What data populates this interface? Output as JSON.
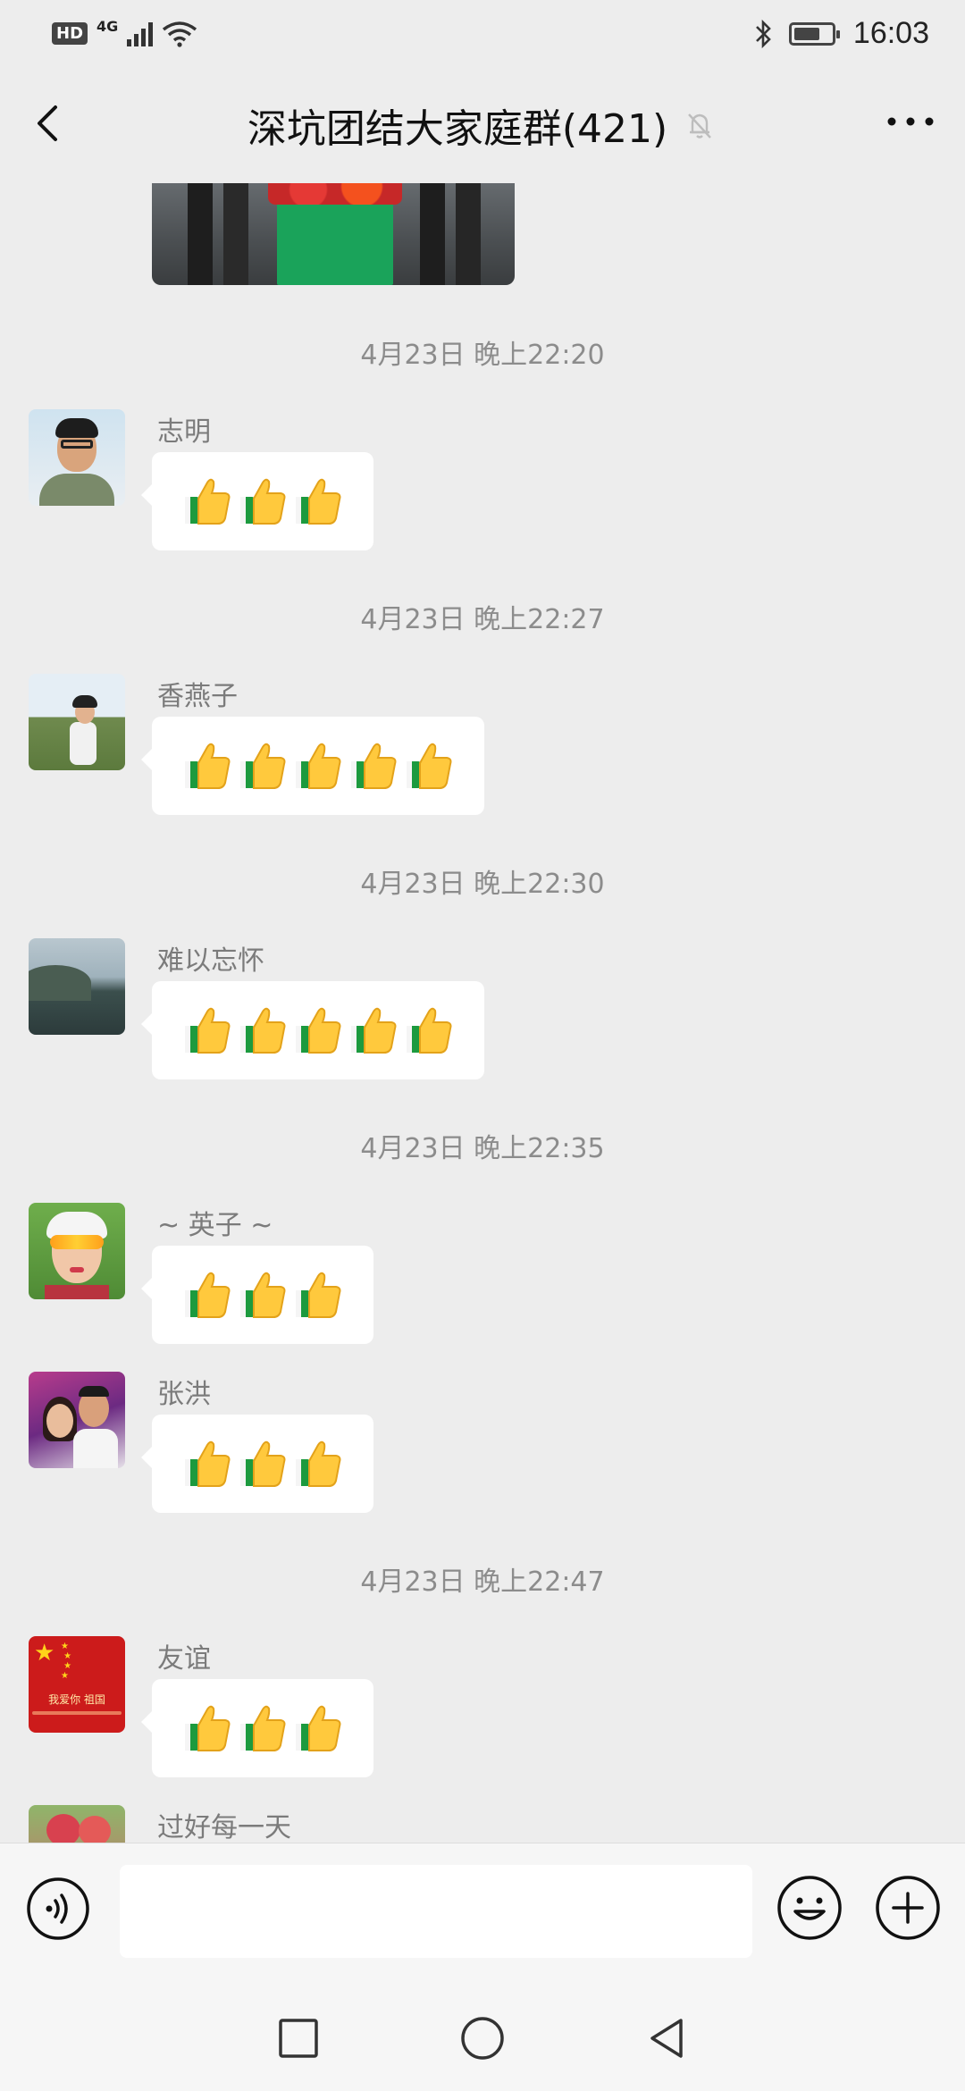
{
  "status_bar": {
    "hd": "HD",
    "network": "4G",
    "time": "16:03"
  },
  "header": {
    "title": "深坑团结大家庭群(421)"
  },
  "messages": [
    {
      "time": "4月23日 晚上22:20",
      "sender": "志明",
      "thumbs": 3,
      "avatar": "avatar-photo"
    },
    {
      "time": "4月23日 晚上22:27",
      "sender": "香燕子",
      "thumbs": 5,
      "avatar": "avatar-photo"
    },
    {
      "time": "4月23日 晚上22:30",
      "sender": "难以忘怀",
      "thumbs": 5,
      "avatar": "avatar-photo"
    },
    {
      "time": "4月23日 晚上22:35",
      "sender": "~ 英子 ~",
      "thumbs": 3,
      "avatar": "avatar-photo"
    },
    {
      "time": "",
      "sender": "张洪",
      "thumbs": 3,
      "avatar": "avatar-photo"
    },
    {
      "time": "4月23日 晚上22:47",
      "sender": "友谊",
      "thumbs": 3,
      "avatar": "avatar-photo"
    },
    {
      "time": "",
      "sender": "过好每一天",
      "thumbs": 0,
      "avatar": "avatar-photo"
    }
  ],
  "flag_avatar_text": "我爱你 祖国",
  "input": {
    "value": "",
    "placeholder": ""
  },
  "icons": {
    "back": "back-arrow-icon",
    "mute": "mute-bell-icon",
    "more": "more-dots-icon",
    "voice": "voice-icon",
    "emoji": "emoji-icon",
    "plus": "plus-icon",
    "thumb": "thumbs-up-icon"
  },
  "colors": {
    "background": "#ededed",
    "bubble": "#ffffff",
    "time_text": "#8c8c8c",
    "sender_text": "#7b7b7b"
  }
}
